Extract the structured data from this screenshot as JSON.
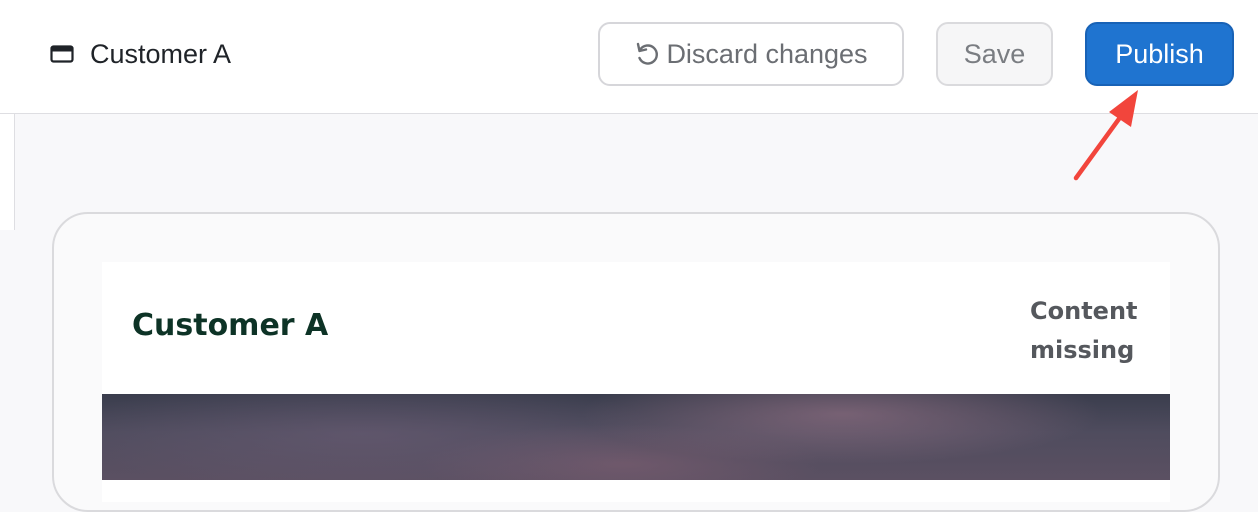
{
  "header": {
    "page_name": "Customer A",
    "page_icon": "browser-window-icon",
    "discard_label": "Discard changes",
    "discard_icon": "undo-icon",
    "save_label": "Save",
    "publish_label": "Publish"
  },
  "preview": {
    "card_title": "Customer A",
    "status_line1": "Content",
    "status_line2": "missing",
    "hero_image": "sky-photo"
  },
  "colors": {
    "publish_bg": "#1f74d0",
    "card_title": "#0d3326",
    "annotation_arrow": "#f2453c"
  }
}
